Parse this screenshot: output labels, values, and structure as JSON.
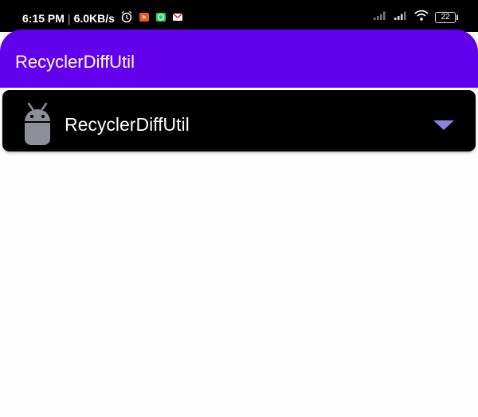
{
  "status_bar": {
    "time": "6:15 PM",
    "network_speed": "6.0KB/s",
    "battery_level": "22",
    "icons": [
      "alarm-icon",
      "video-icon",
      "whatsapp-icon",
      "gmail-icon",
      "signal-icon",
      "signal-icon",
      "wifi-icon",
      "battery-icon"
    ]
  },
  "app_bar": {
    "title": "RecyclerDiffUtil"
  },
  "spinner": {
    "selected_label": "RecyclerDiffUtil",
    "icon": "android-icon",
    "arrow_icon": "dropdown-arrow-icon"
  },
  "colors": {
    "app_bar": "#6200ee",
    "spinner_bg": "#000000",
    "arrow": "#8b80e6",
    "page_bg": "#fefefe"
  }
}
